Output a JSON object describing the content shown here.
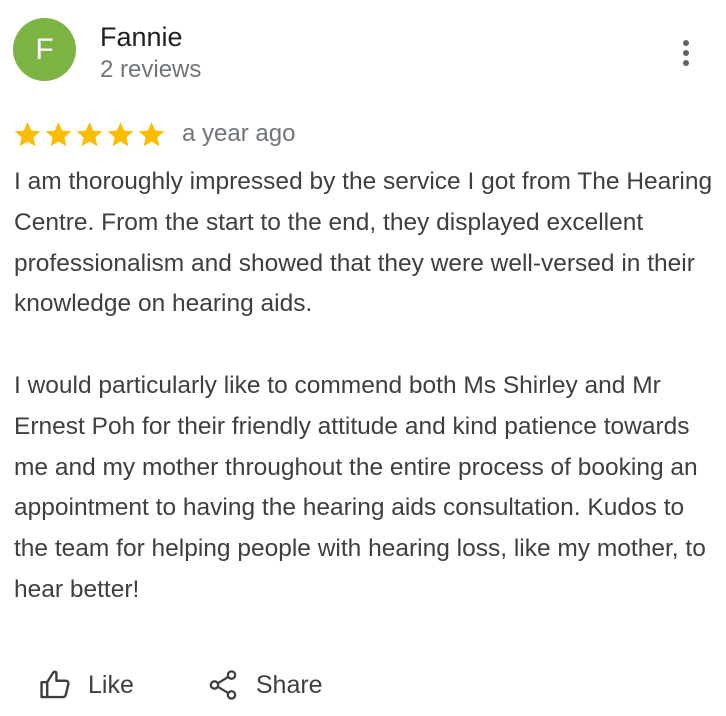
{
  "review": {
    "author": {
      "initial": "F",
      "name": "Fannie",
      "meta": "2 reviews",
      "avatar_color": "#7cb342"
    },
    "rating": 5,
    "rating_max": 5,
    "star_color": "#fbbc04",
    "date": "a year ago",
    "text": "I am thoroughly impressed by the service I got from The Hearing Centre. From the start to the end, they displayed excellent professionalism and showed that they were well-versed in their knowledge on hearing aids.\n\nI would particularly like to commend both Ms Shirley and Mr Ernest Poh for their friendly attitude and kind patience towards me and my mother throughout the entire process of booking an appointment to having the hearing aids consultation. Kudos to the team for helping people with hearing loss, like my mother, to hear better!",
    "menu_icon": "more-vert-icon"
  },
  "actions": {
    "like_label": "Like",
    "like_icon": "thumb-up-icon",
    "share_label": "Share",
    "share_icon": "share-icon"
  }
}
